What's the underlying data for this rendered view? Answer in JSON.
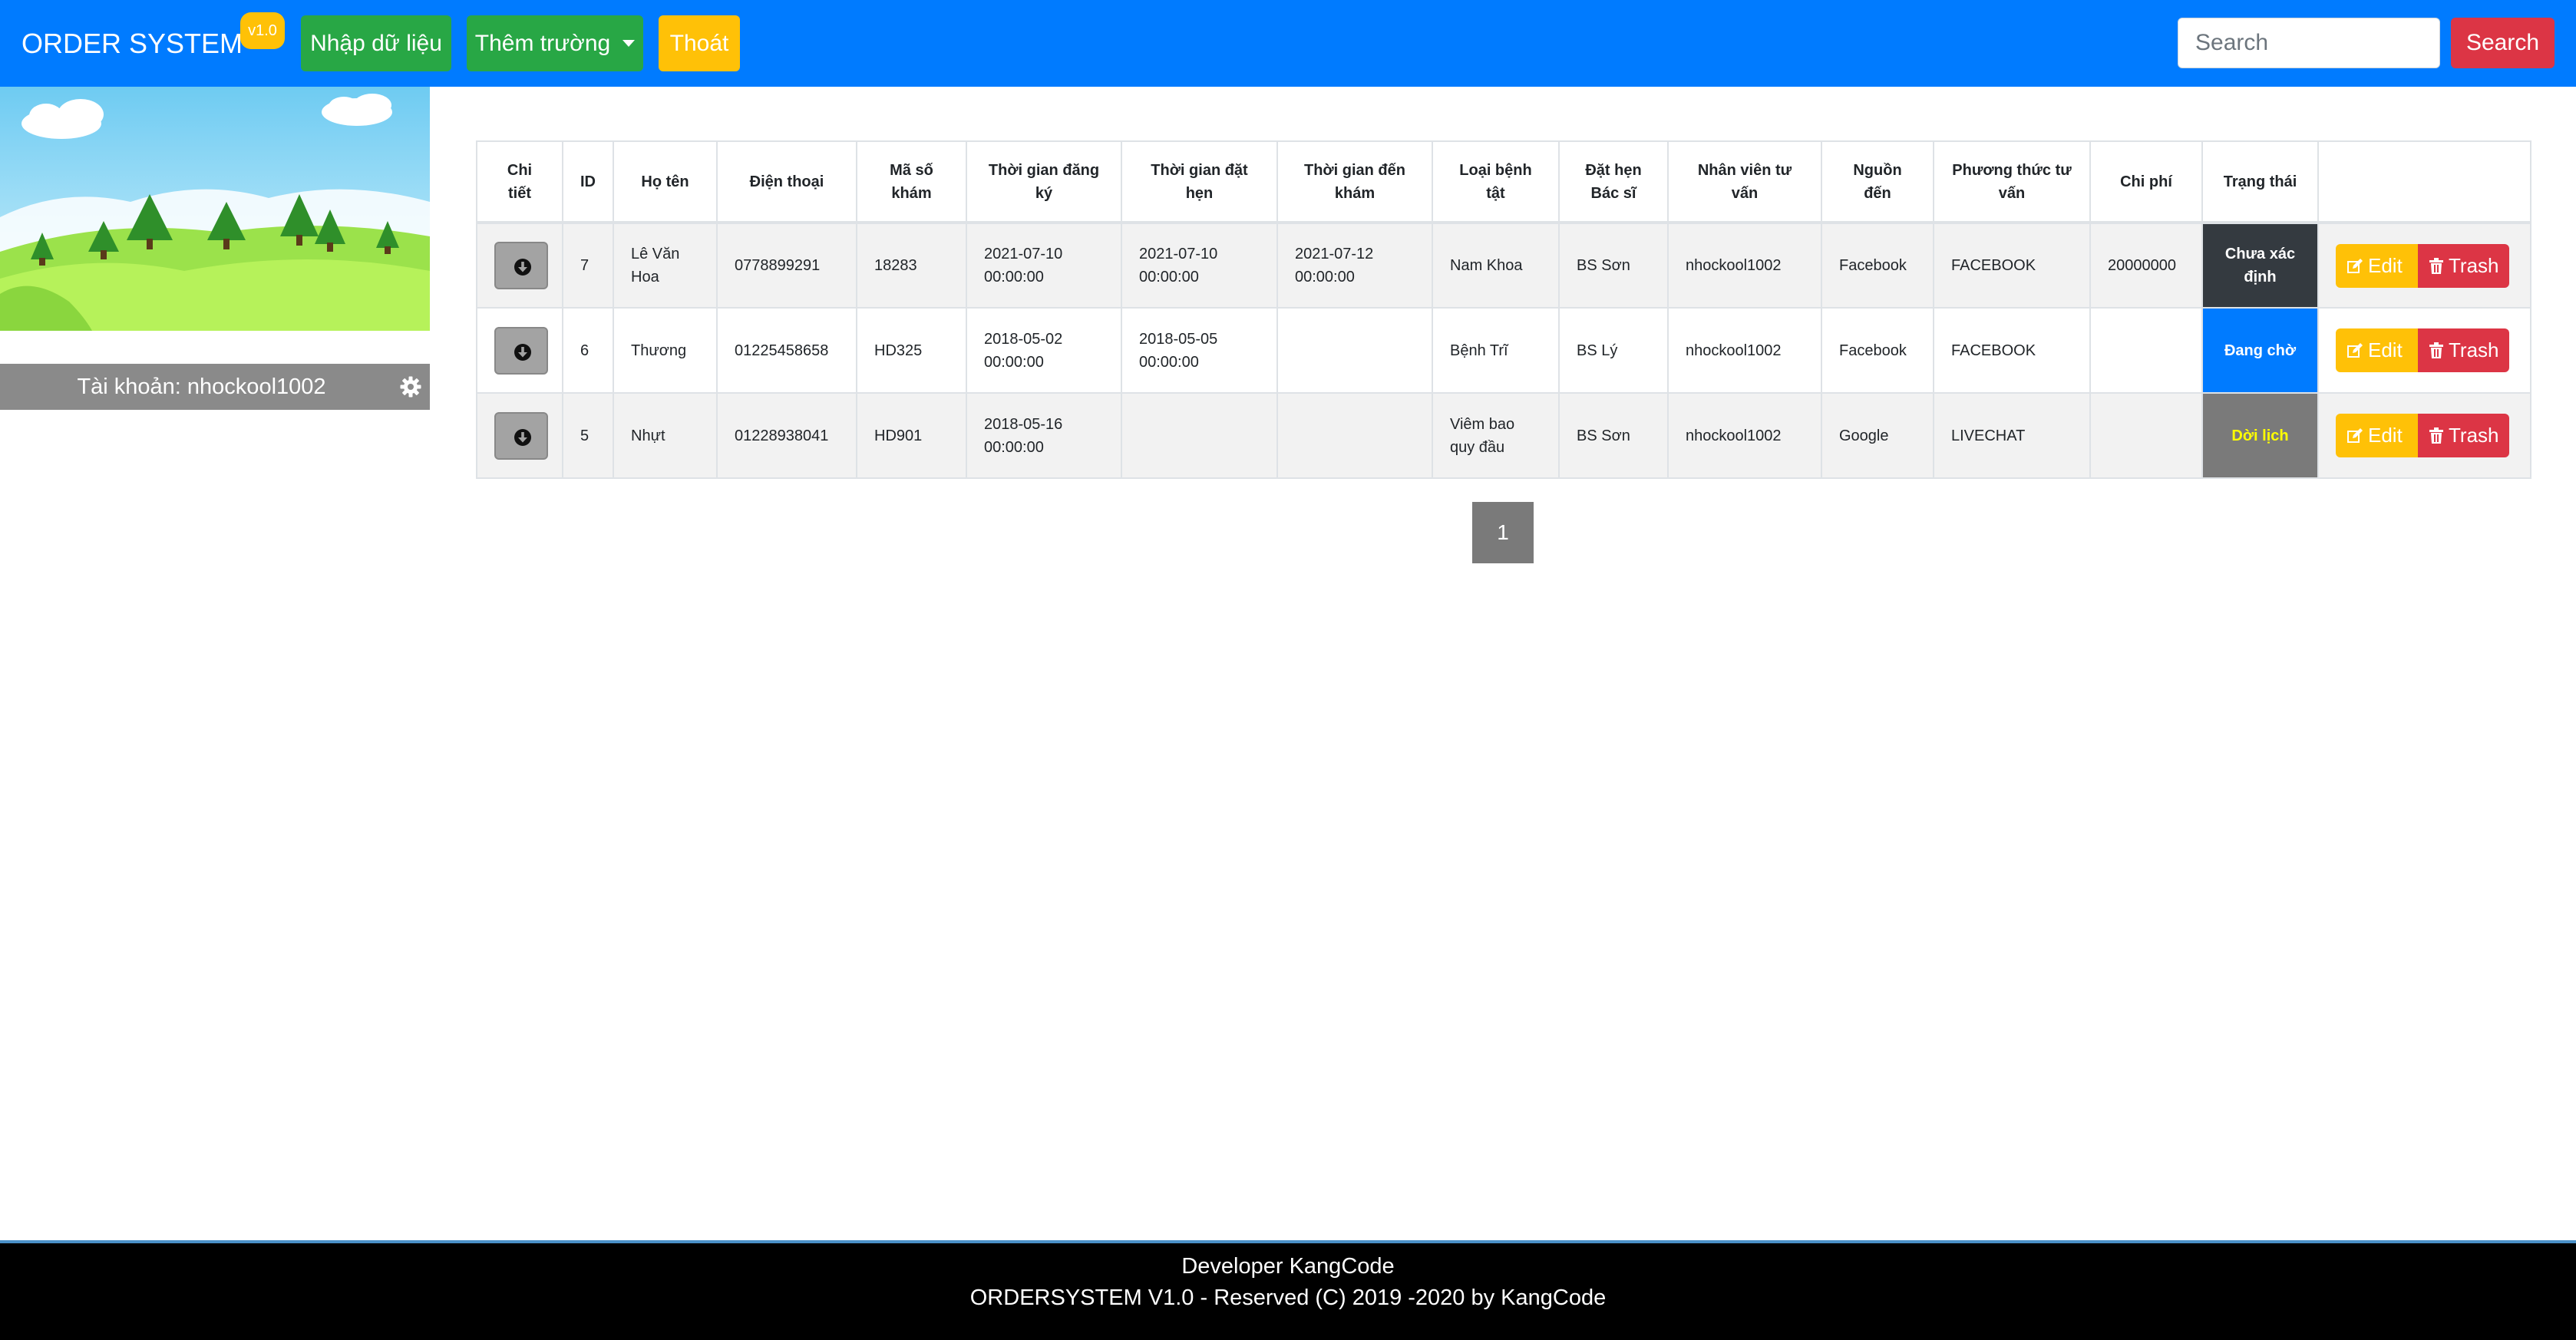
{
  "navbar": {
    "brand": "ORDER SYSTEM",
    "version": "v1.0",
    "import_label": "Nhập dữ liệu",
    "add_field_label": "Thêm trường",
    "logout_label": "Thoát",
    "search_placeholder": "Search",
    "search_button": "Search"
  },
  "sidebar": {
    "account_label": "Tài khoản: nhockool1002"
  },
  "table": {
    "headers": {
      "detail": "Chi tiết",
      "id": "ID",
      "name": "Họ tên",
      "phone": "Điện thoại",
      "code": "Mã số khám",
      "reg_time": "Thời gian đăng ký",
      "appt_time": "Thời gian đặt hẹn",
      "visit_time": "Thời gian đến khám",
      "disease": "Loại bệnh tật",
      "doctor": "Đặt hẹn Bác sĩ",
      "staff": "Nhân viên tư vấn",
      "source": "Nguồn đến",
      "method": "Phương thức tư vấn",
      "cost": "Chi phí",
      "status": "Trạng thái"
    },
    "rows": [
      {
        "id": "7",
        "name": "Lê Văn Hoa",
        "phone": "0778899291",
        "code": "18283",
        "reg_time": "2021-07-10 00:00:00",
        "appt_time": "2021-07-10 00:00:00",
        "visit_time": "2021-07-12 00:00:00",
        "disease": "Nam Khoa",
        "doctor": "BS Sơn",
        "staff": "nhockool1002",
        "source": "Facebook",
        "method": "FACEBOOK",
        "cost": "20000000",
        "status": "Chưa xác định",
        "edit": "Edit",
        "trash": "Trash"
      },
      {
        "id": "6",
        "name": "Thương",
        "phone": "01225458658",
        "code": "HD325",
        "reg_time": "2018-05-02 00:00:00",
        "appt_time": "2018-05-05 00:00:00",
        "visit_time": "",
        "disease": "Bệnh Trĩ",
        "doctor": "BS Lý",
        "staff": "nhockool1002",
        "source": "Facebook",
        "method": "FACEBOOK",
        "cost": "",
        "status": "Đang chờ",
        "edit": "Edit",
        "trash": "Trash"
      },
      {
        "id": "5",
        "name": "Nhựt",
        "phone": "01228938041",
        "code": "HD901",
        "reg_time": "2018-05-16 00:00:00",
        "appt_time": "",
        "visit_time": "",
        "disease": "Viêm bao quy đầu",
        "doctor": "BS Sơn",
        "staff": "nhockool1002",
        "source": "Google",
        "method": "LIVECHAT",
        "cost": "",
        "status": "Dời lịch",
        "edit": "Edit",
        "trash": "Trash"
      }
    ]
  },
  "status_colors": {
    "undetermined": {
      "bg": "#343a40",
      "fg": "#ffffff"
    },
    "waiting": {
      "bg": "#007bff",
      "fg": "#ffffff"
    },
    "rescheduled": {
      "bg": "#7a7a7a",
      "fg": "#ffff00"
    }
  },
  "pagination": {
    "current": "1"
  },
  "footer": {
    "line1": "Developer KangCode",
    "line2": "ORDERSYSTEM V1.0 - Reserved (C) 2019 -2020 by KangCode"
  },
  "colors": {
    "navbar": "#007bff",
    "success": "#28a745",
    "warning": "#ffc107",
    "danger": "#dc3545"
  }
}
